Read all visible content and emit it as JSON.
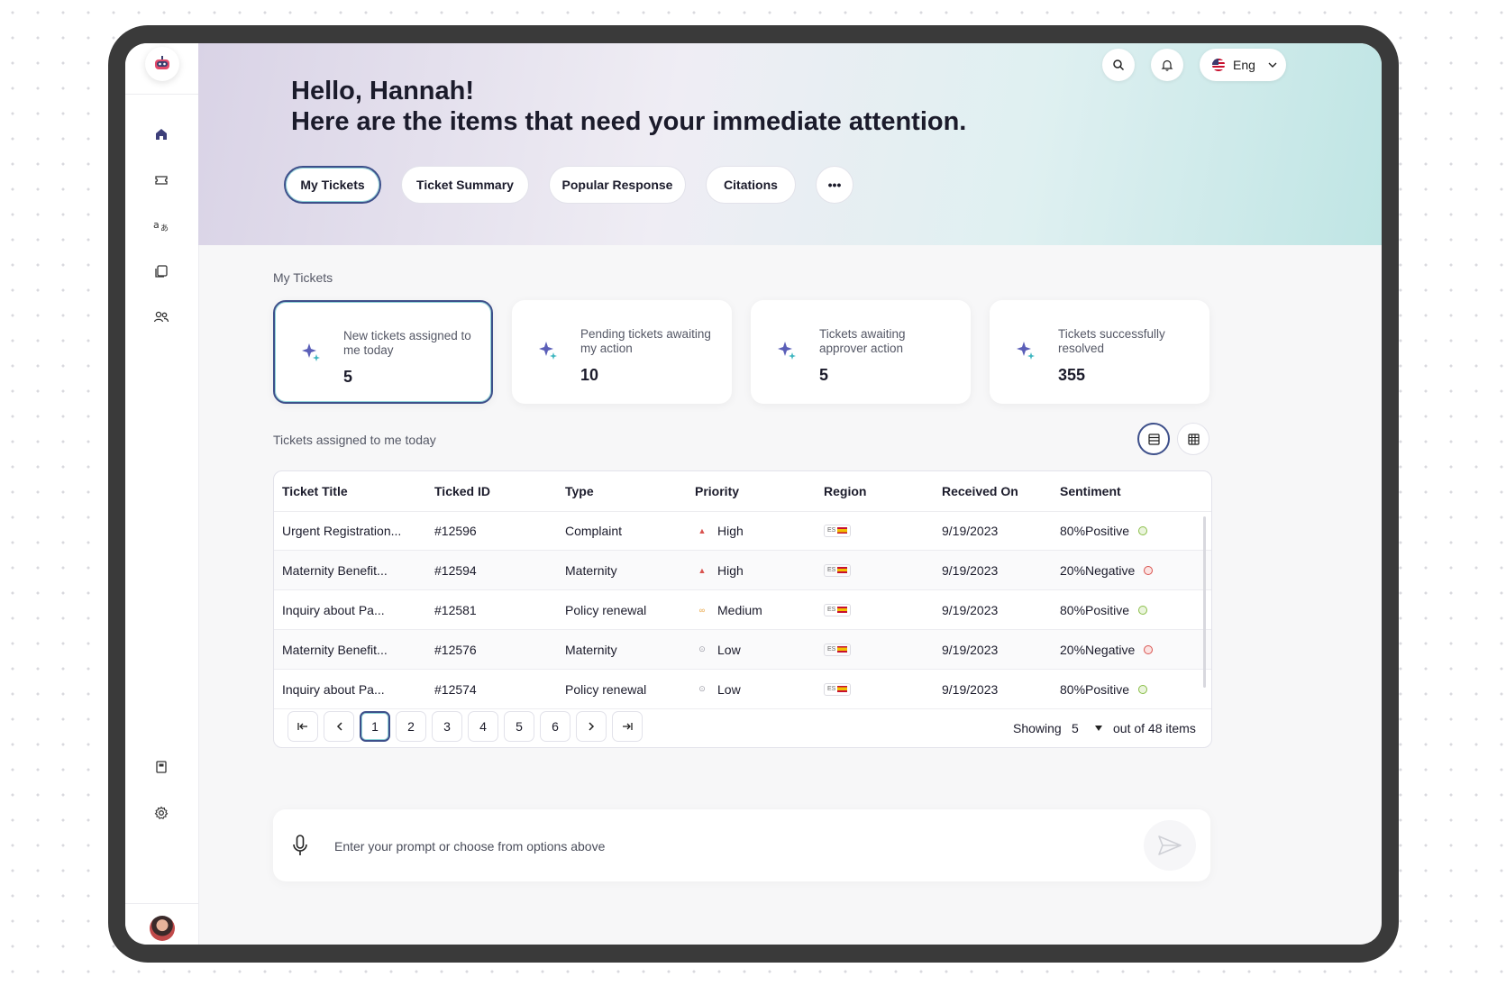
{
  "header": {
    "greeting": "Hello, Hannah!",
    "subtitle": "Here are the items that need your immediate attention.",
    "language": "Eng"
  },
  "pills": [
    {
      "label": "My Tickets",
      "active": true
    },
    {
      "label": "Ticket Summary"
    },
    {
      "label": "Popular Response"
    },
    {
      "label": "Citations"
    },
    {
      "label": "•••"
    }
  ],
  "my_tickets": {
    "section_label": "My Tickets",
    "cards": [
      {
        "label": "New tickets assigned to me today",
        "value": "5"
      },
      {
        "label": "Pending tickets awaiting my action",
        "value": "10"
      },
      {
        "label": "Tickets awaiting approver action",
        "value": "5"
      },
      {
        "label": "Tickets successfully resolved",
        "value": "355"
      }
    ]
  },
  "table": {
    "section_label": "Tickets assigned to me today",
    "columns": [
      "Ticket Title",
      "Ticked ID",
      "Type",
      "Priority",
      "Region",
      "Received On",
      "Sentiment"
    ],
    "rows": [
      {
        "title": "Urgent Registration...",
        "id": "#12596",
        "type": "Complaint",
        "priority": "High",
        "region": "ES",
        "received": "9/19/2023",
        "sentiment": "80%Positive"
      },
      {
        "title": "Maternity Benefit...",
        "id": "#12594",
        "type": "Maternity",
        "priority": "High",
        "region": "ES",
        "received": "9/19/2023",
        "sentiment": "20%Negative"
      },
      {
        "title": "Inquiry about Pa...",
        "id": "#12581",
        "type": "Policy renewal",
        "priority": "Medium",
        "region": "ES",
        "received": "9/19/2023",
        "sentiment": "80%Positive"
      },
      {
        "title": "Maternity Benefit...",
        "id": "#12576",
        "type": "Maternity",
        "priority": "Low",
        "region": "ES",
        "received": "9/19/2023",
        "sentiment": "20%Negative"
      },
      {
        "title": "Inquiry about Pa...",
        "id": "#12574",
        "type": "Policy renewal",
        "priority": "Low",
        "region": "ES",
        "received": "9/19/2023",
        "sentiment": "80%Positive"
      }
    ]
  },
  "pagination": {
    "pages": [
      "1",
      "2",
      "3",
      "4",
      "5",
      "6"
    ],
    "current": "1",
    "showing_label": "Showing",
    "page_size": "5",
    "total_label": "out of 48 items"
  },
  "prompt": {
    "placeholder": "Enter your prompt or choose from options above"
  },
  "colors": {
    "accent": "#3d4f8a",
    "accent_teal": "#8fd3d8",
    "high": "#d9534f",
    "medium": "#e8a13c",
    "low": "#9a9aa5",
    "positive": "#8bbf4a",
    "negative": "#d9534f"
  }
}
